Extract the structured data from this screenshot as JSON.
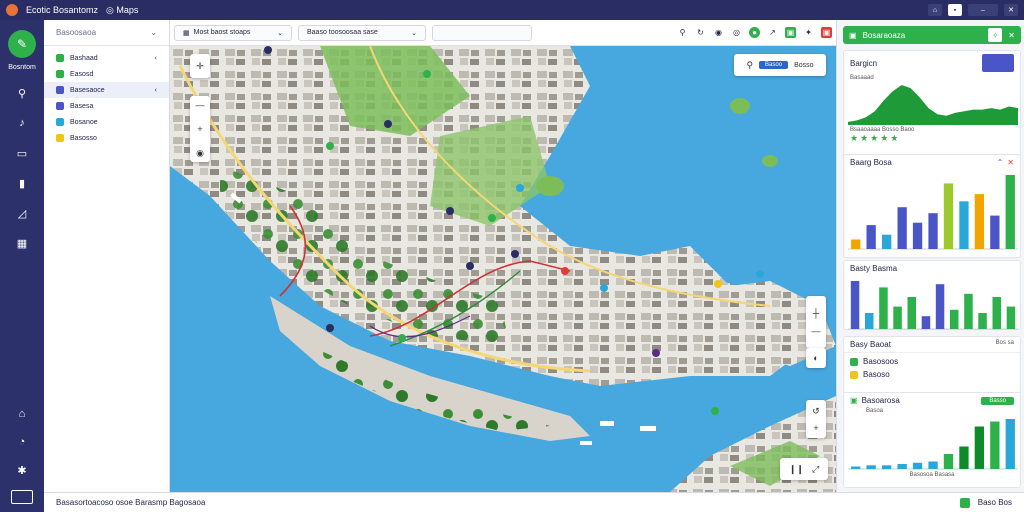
{
  "titlebar": {
    "app_title": "Ecotic Bosantomz",
    "tab_label": "Maps"
  },
  "rail": {
    "brand_label": "Bosntom"
  },
  "side": {
    "header": "Basoosaoa",
    "items": [
      {
        "label": "Bashaad",
        "color": "#2eb04b"
      },
      {
        "label": "Easosd",
        "color": "#2eb04b"
      },
      {
        "label": "Basesaoce",
        "color": "#4a56c8"
      },
      {
        "label": "Basesa",
        "color": "#4a56c8"
      },
      {
        "label": "Bosanoe",
        "color": "#2aa7d8"
      },
      {
        "label": "Basosso",
        "color": "#f0c419"
      }
    ]
  },
  "topbar": {
    "chip1": "Most baost stoaps",
    "chip2": "Baaso toosoosaa sase",
    "chip3": ""
  },
  "map": {
    "overlay_button": "Bosso",
    "overlay_chip": "Basoo"
  },
  "right": {
    "header_title": "Bosaraoaza",
    "card1": {
      "title": "Bargicn",
      "subtitle": "Basaaad",
      "legend": "Bsaaoaaaa Bosso Baoo",
      "chart_data": {
        "type": "area",
        "values": [
          2,
          3,
          5,
          9,
          16,
          22,
          26,
          24,
          18,
          11,
          7,
          6,
          8,
          9,
          10,
          10,
          11,
          10,
          12,
          11
        ]
      }
    },
    "card2": {
      "title": "Baarg Bosa",
      "chart_data": {
        "type": "bar",
        "values": [
          8,
          20,
          12,
          35,
          22,
          30,
          55,
          40,
          46,
          28,
          62
        ],
        "colors": [
          "#f0a500",
          "#4a56c8",
          "#2aa7d8",
          "#4a56c8",
          "#4a56c8",
          "#4a56c8",
          "#9cc92e",
          "#2aa7d8",
          "#f0a500",
          "#4a56c8",
          "#2eb04b"
        ]
      }
    },
    "card3": {
      "title": "Basty Basma",
      "chart_data": {
        "type": "bar",
        "values": [
          30,
          10,
          26,
          14,
          20,
          8,
          28,
          12,
          22,
          10,
          20,
          14
        ],
        "colors": [
          "#4a56c8",
          "#2aa7d8",
          "#2eb04b",
          "#2eb04b",
          "#2eb04b",
          "#4a56c8",
          "#4a56c8",
          "#2eb04b",
          "#2eb04b",
          "#2eb04b",
          "#2eb04b",
          "#2eb04b"
        ]
      }
    },
    "card4": {
      "title": "Basy Baoat",
      "right_label": "Bos sa",
      "item1": "Basosoos",
      "item2": "Basoso"
    },
    "card5": {
      "title": "Basoarosa",
      "button": "Basso",
      "sub": "Basoa",
      "footer": "Basosoa Basasa",
      "chart_data": {
        "type": "bar",
        "values": [
          2,
          3,
          3,
          4,
          5,
          6,
          12,
          18,
          34,
          38,
          40
        ],
        "colors": [
          "#2aa7d8",
          "#2aa7d8",
          "#2aa7d8",
          "#2aa7d8",
          "#2aa7d8",
          "#2aa7d8",
          "#2eb04b",
          "#0f8a2a",
          "#0f8a2a",
          "#2eb04b",
          "#2aa7d8"
        ]
      }
    }
  },
  "bottombar": {
    "left": "Basasortoacoso osoe Barasmp Bagosaoa",
    "right": "Baso Bos"
  }
}
